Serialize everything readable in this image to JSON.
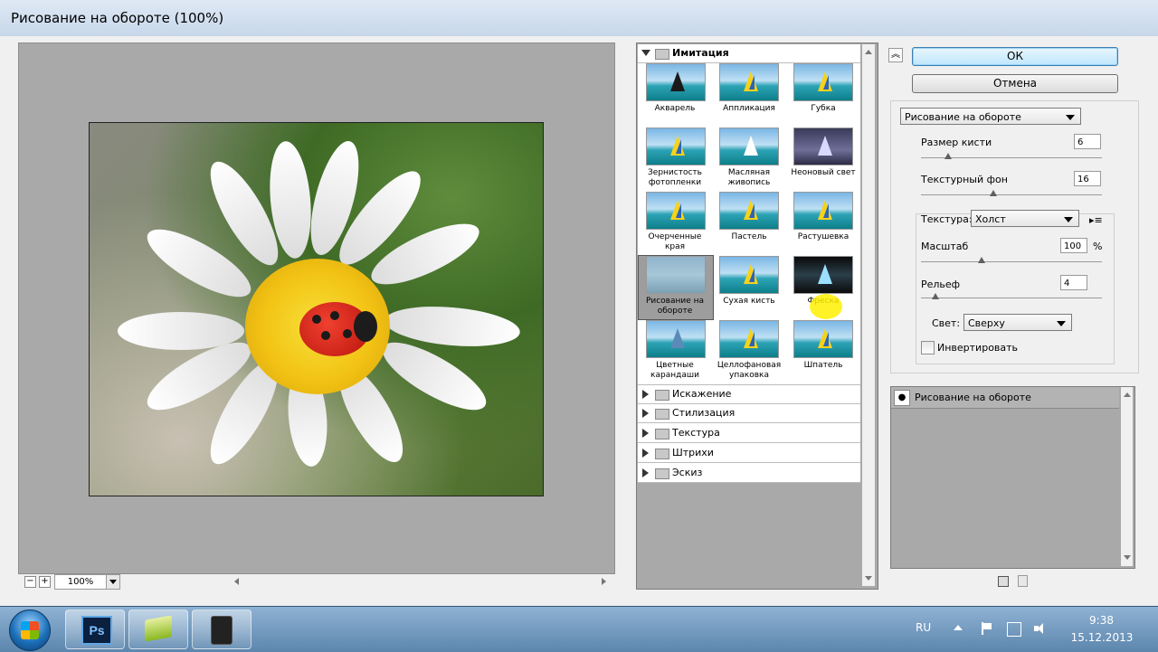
{
  "window": {
    "title": "Рисование на обороте (100%)"
  },
  "preview": {
    "zoom": "100%",
    "zoom_out": "−",
    "zoom_in": "+"
  },
  "gallery": {
    "open_category": "Имитация",
    "filters": [
      {
        "name": "Акварель"
      },
      {
        "name": "Аппликация"
      },
      {
        "name": "Губка"
      },
      {
        "name": "Зернистость фотопленки"
      },
      {
        "name": "Масляная живопись"
      },
      {
        "name": "Неоновый свет"
      },
      {
        "name": "Очерченные края"
      },
      {
        "name": "Пастель"
      },
      {
        "name": "Растушевка"
      },
      {
        "name": "Рисование на обороте"
      },
      {
        "name": "Сухая кисть"
      },
      {
        "name": "Фреска"
      },
      {
        "name": "Цветные карандаши"
      },
      {
        "name": "Целлофановая упаковка"
      },
      {
        "name": "Шпатель"
      }
    ],
    "selected_filter": "Рисование на обороте",
    "collapsed_categories": [
      "Искажение",
      "Стилизация",
      "Текстура",
      "Штрихи",
      "Эскиз"
    ]
  },
  "buttons": {
    "ok": "ОК",
    "cancel": "Отмена"
  },
  "settings": {
    "filter_select": "Рисование на обороте",
    "brush_size_label": "Размер кисти",
    "brush_size": "6",
    "texture_bg_label": "Текстурный фон",
    "texture_bg": "16",
    "texture_label": "Текстура:",
    "texture_value": "Холст",
    "scale_label": "Масштаб",
    "scale": "100",
    "scale_unit": "%",
    "relief_label": "Рельеф",
    "relief": "4",
    "light_label": "Свет:",
    "light_value": "Сверху",
    "invert_label": "Инвертировать",
    "invert_checked": false
  },
  "layers": {
    "items": [
      "Рисование на обороте"
    ]
  },
  "taskbar": {
    "lang": "RU",
    "time": "9:38",
    "date": "15.12.2013",
    "apps": [
      "Ps",
      "",
      ""
    ]
  }
}
